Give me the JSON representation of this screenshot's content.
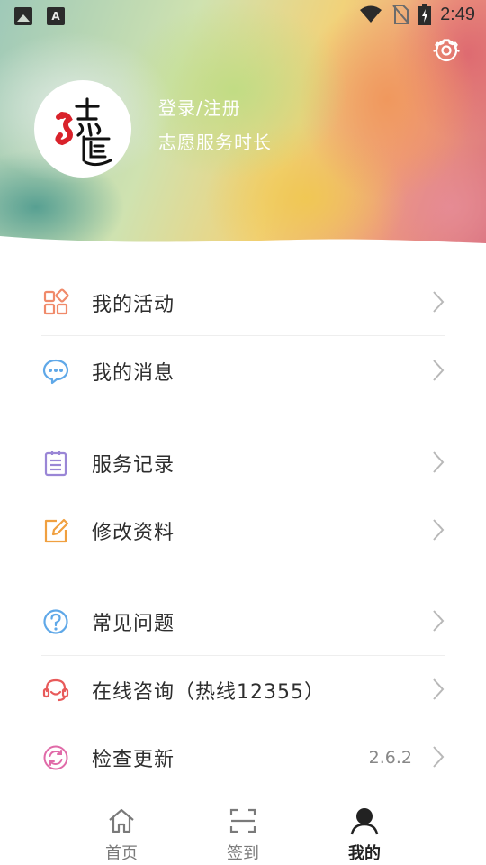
{
  "status_bar": {
    "time": "2:49"
  },
  "profile": {
    "login_text": "登录/注册",
    "service_hours_label": "志愿服务时长"
  },
  "menu": [
    {
      "label": "我的活动",
      "icon": "grid-apps-icon",
      "color": "#f08a6a"
    },
    {
      "label": "我的消息",
      "icon": "chat-bubble-icon",
      "color": "#5fa8e8"
    },
    {
      "label": "服务记录",
      "icon": "clipboard-list-icon",
      "color": "#9a86d6"
    },
    {
      "label": "修改资料",
      "icon": "edit-icon",
      "color": "#f0a040"
    },
    {
      "label": "常见问题",
      "icon": "question-icon",
      "color": "#5fa8e8"
    },
    {
      "label": "在线咨询（热线12355）",
      "icon": "headset-icon",
      "color": "#e85a5a"
    },
    {
      "label": "检查更新",
      "icon": "refresh-icon",
      "color": "#e06aa8",
      "value": "2.6.2"
    }
  ],
  "bottom_nav": [
    {
      "label": "首页",
      "icon": "home-icon",
      "active": false
    },
    {
      "label": "签到",
      "icon": "scan-icon",
      "active": false
    },
    {
      "label": "我的",
      "icon": "person-icon",
      "active": true
    }
  ]
}
